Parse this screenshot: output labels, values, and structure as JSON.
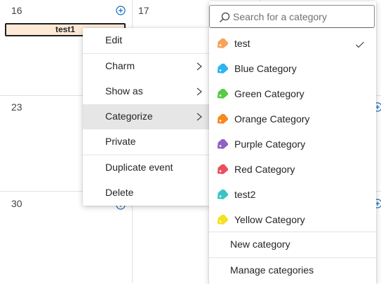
{
  "calendar": {
    "days": [
      {
        "num": "16"
      },
      {
        "num": "17"
      },
      {
        "num": "23"
      },
      {
        "num": "30"
      }
    ],
    "event": {
      "title": "test1",
      "color": "#fde9d6"
    }
  },
  "context_menu": {
    "items": [
      {
        "label": "Edit"
      },
      {
        "label": "Charm",
        "submenu": true
      },
      {
        "label": "Show as",
        "submenu": true
      },
      {
        "label": "Categorize",
        "submenu": true,
        "active": true
      },
      {
        "label": "Private"
      },
      {
        "label": "Duplicate event"
      },
      {
        "label": "Delete"
      }
    ]
  },
  "category_menu": {
    "search_placeholder": "Search for a category",
    "categories": [
      {
        "label": "test",
        "color": "#f7a35c",
        "checked": true
      },
      {
        "label": "Blue Category",
        "color": "#2bb5f0"
      },
      {
        "label": "Green Category",
        "color": "#58c948"
      },
      {
        "label": "Orange Category",
        "color": "#f58a1f"
      },
      {
        "label": "Purple Category",
        "color": "#8d62c4"
      },
      {
        "label": "Red Category",
        "color": "#e8505b"
      },
      {
        "label": "test2",
        "color": "#3cc4c4"
      },
      {
        "label": "Yellow Category",
        "color": "#f5e11e"
      }
    ],
    "actions": [
      {
        "label": "New category"
      },
      {
        "label": "Manage categories"
      }
    ]
  }
}
